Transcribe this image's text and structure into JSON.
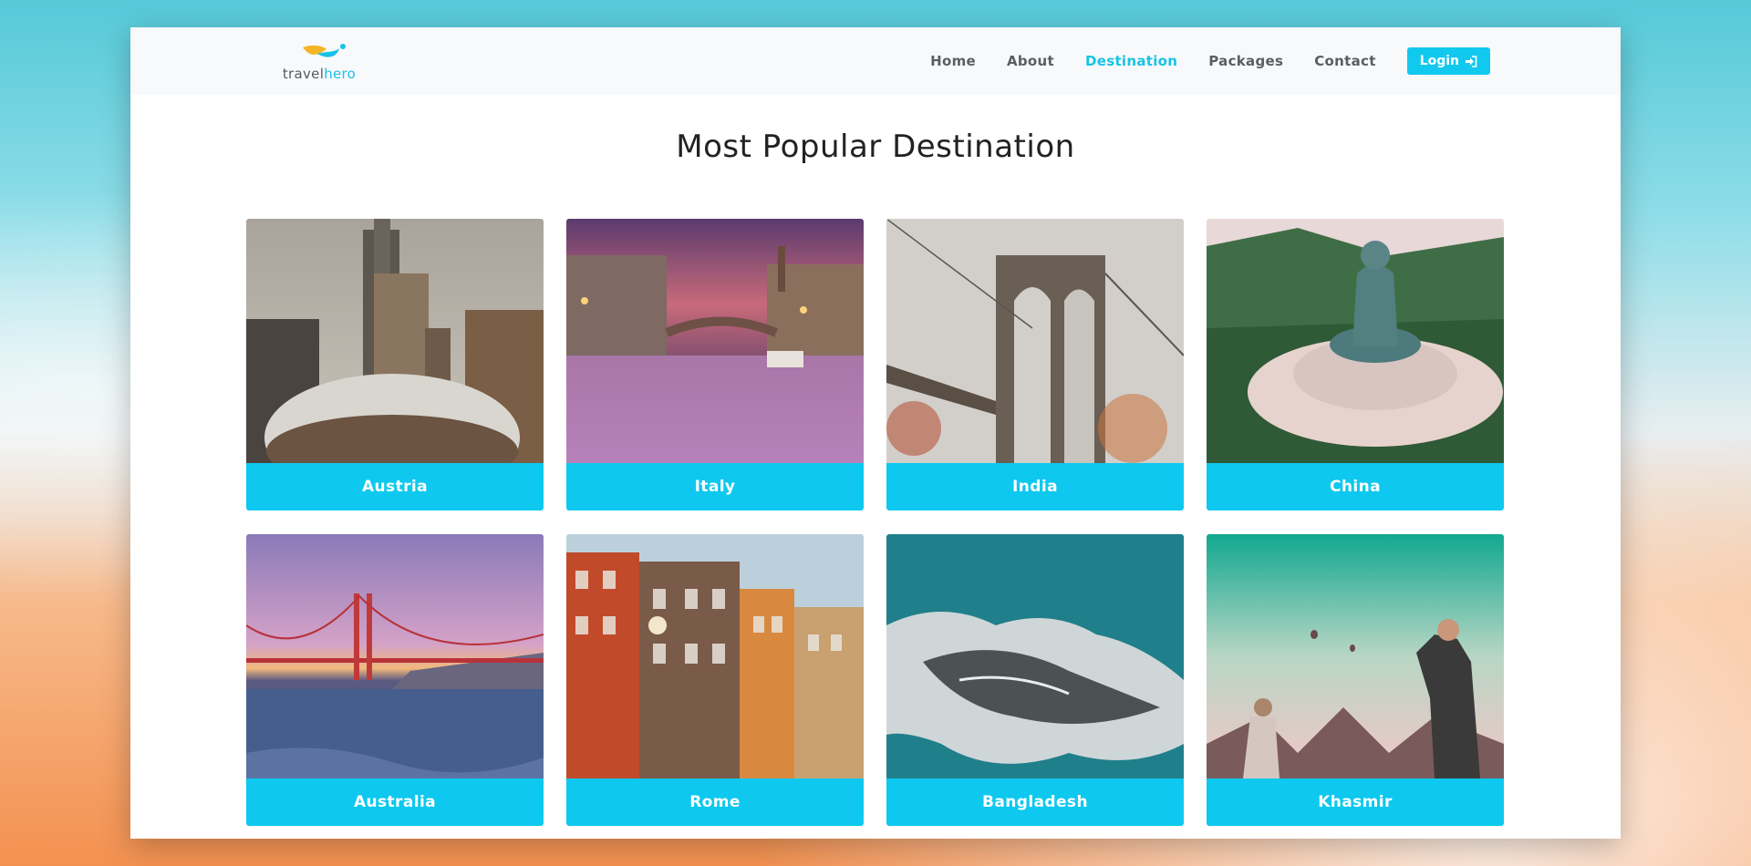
{
  "brand": {
    "name_part1": "travel",
    "name_part2": "hero"
  },
  "nav": {
    "items": [
      {
        "label": "Home"
      },
      {
        "label": "About"
      },
      {
        "label": "Destination"
      },
      {
        "label": "Packages"
      },
      {
        "label": "Contact"
      }
    ],
    "active": "Destination",
    "login_label": "Login"
  },
  "page": {
    "title": "Most Popular Destination"
  },
  "destinations": [
    {
      "name": "Austria"
    },
    {
      "name": "Italy"
    },
    {
      "name": "India"
    },
    {
      "name": "China"
    },
    {
      "name": "Australia"
    },
    {
      "name": "Rome"
    },
    {
      "name": "Bangladesh"
    },
    {
      "name": "Khasmir"
    }
  ],
  "colors": {
    "accent": "#0ec8ef",
    "nav_bg": "#f8f9fa",
    "logo_yellow": "#f5b526"
  }
}
